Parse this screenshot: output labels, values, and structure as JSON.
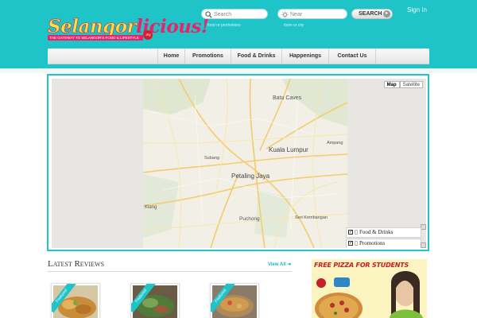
{
  "brand": {
    "logo_part1": "Selangor",
    "logo_part2": "licious!",
    "tagline": "THE GATEWAY TO SELANGOR'S FOOD & LIFESTYLE",
    "badge": ".my"
  },
  "search": {
    "query_placeholder": "Search",
    "query_hint": "food or promotions",
    "near_placeholder": "Near",
    "near_hint": "town or city",
    "button_label": "SEARCH"
  },
  "account": {
    "signin_label": "Sign In"
  },
  "nav": {
    "items": [
      {
        "label": "Home"
      },
      {
        "label": "Promotions"
      },
      {
        "label": "Food & Drinks"
      },
      {
        "label": "Happenings"
      },
      {
        "label": "Contact Us"
      }
    ]
  },
  "map": {
    "type_buttons": [
      "Map",
      "Satellite"
    ],
    "selected_type": "Map",
    "labels": [
      "Batu Caves",
      "Ampang",
      "Kuala Lumpur",
      "Subang",
      "Petaling Jaya",
      "Klang",
      "Puchong",
      "Seri Kembangan"
    ],
    "legend": [
      {
        "label": "Food & Drinks",
        "checked": true
      },
      {
        "label": "Promotions",
        "checked": true
      }
    ]
  },
  "reviews": {
    "title": "Latest Reviews",
    "view_all_label": "View All",
    "cards": [
      {
        "ribbon": "Featured"
      },
      {
        "ribbon": "Featured"
      },
      {
        "ribbon": "Featured"
      }
    ]
  },
  "ad": {
    "title": "FREE PIZZA FOR STUDENTS"
  },
  "colors": {
    "header_teal": "#1fc4c9",
    "brand_pink": "#e8236a",
    "brand_yellow": "#f6e04b",
    "ad_red": "#c2202a"
  }
}
